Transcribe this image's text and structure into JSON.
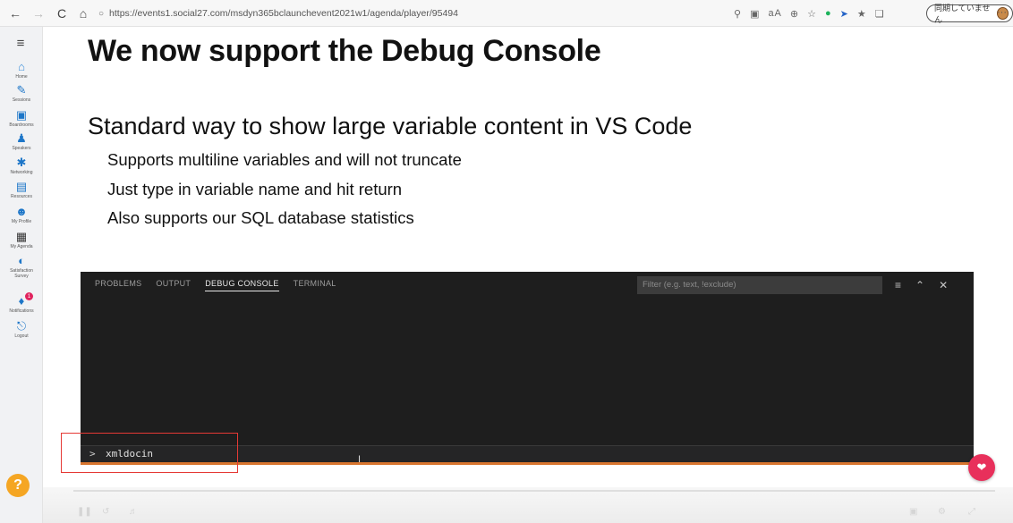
{
  "browser": {
    "back_icon": "←",
    "forward_icon": "→",
    "reload_icon": "C",
    "home_icon": "⌂",
    "url": "https://events1.social27.com/msdyn365bclaunchevent2021w1/agenda/player/95494",
    "sync_label": "同期していません",
    "more_icon": "···"
  },
  "sidebar": {
    "items": [
      {
        "label": "Home",
        "icon": "home-icon"
      },
      {
        "label": "Sessions",
        "icon": "pen-icon"
      },
      {
        "label": "Boardrooms",
        "icon": "boardroom-icon"
      },
      {
        "label": "Speakers",
        "icon": "speaker-icon"
      },
      {
        "label": "Networking",
        "icon": "network-icon"
      },
      {
        "label": "Resources",
        "icon": "resources-icon"
      },
      {
        "label": "My Profile",
        "icon": "profile-icon"
      },
      {
        "label": "My Agenda",
        "icon": "calendar-icon"
      },
      {
        "label": "Satisfaction Survey",
        "icon": "survey-icon"
      },
      {
        "label": "Notifications",
        "icon": "bell-icon"
      },
      {
        "label": "Logout",
        "icon": "logout-icon"
      }
    ],
    "notification_count": "1",
    "help_label": "?"
  },
  "slide": {
    "title": "We now support the Debug Console",
    "subtitle": "Standard way to show large variable content in VS Code",
    "bullets": [
      "Supports multiline variables and will not truncate",
      "Just type in variable name and hit return",
      "Also supports our SQL database statistics"
    ]
  },
  "panel": {
    "tabs": [
      "PROBLEMS",
      "OUTPUT",
      "DEBUG CONSOLE",
      "TERMINAL"
    ],
    "active_tab": "DEBUG CONSOLE",
    "filter_placeholder": "Filter (e.g. text, !exclude)",
    "prompt_symbol": ">",
    "input_value": "xmldocin"
  }
}
